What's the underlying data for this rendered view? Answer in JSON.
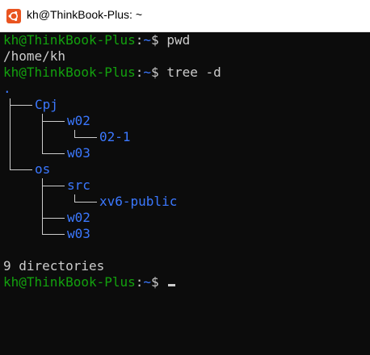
{
  "window": {
    "title": "kh@ThinkBook-Plus: ~"
  },
  "prompt": {
    "user_host": "kh@ThinkBook-Plus",
    "sep": ":",
    "path": "~",
    "symbol": "$"
  },
  "commands": {
    "cmd1": "pwd",
    "out1": "/home/kh",
    "cmd2": "tree -d"
  },
  "tree": {
    "root": ".",
    "n_cpj": "Cpj",
    "n_w02_a": "w02",
    "n_02_1": "02-1",
    "n_w03_a": "w03",
    "n_os": "os",
    "n_src": "src",
    "n_xv6": "xv6-public",
    "n_w02_b": "w02",
    "n_w03_b": "w03"
  },
  "summary": "9 directories",
  "colors": {
    "background": "#0c0c0c",
    "prompt_green": "#13a10e",
    "directory_blue": "#3b78ff",
    "text": "#cccccc"
  },
  "icons": {
    "app": "ubuntu-logo-icon"
  }
}
